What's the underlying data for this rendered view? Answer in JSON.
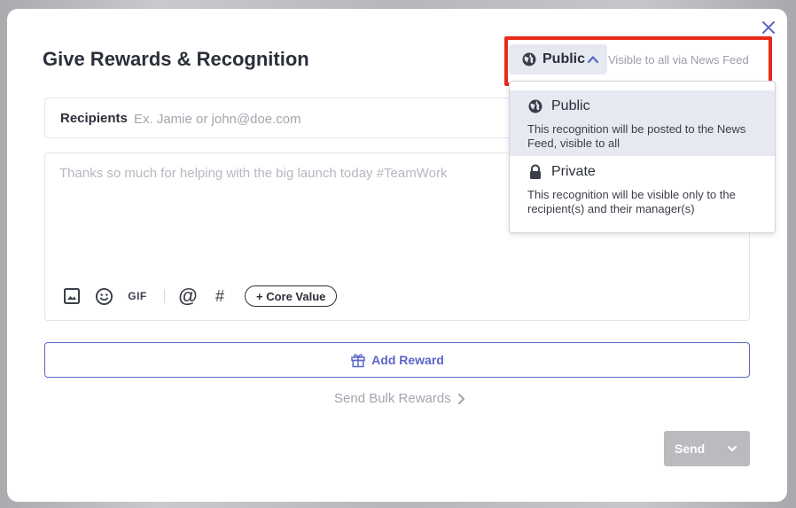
{
  "modal": {
    "title": "Give Rewards & Recognition"
  },
  "visibility": {
    "selected_label": "Public",
    "hint": "Visible to all via News Feed",
    "options": [
      {
        "label": "Public",
        "description": "This recognition will be posted to the News Feed, visible to all",
        "icon": "globe-icon"
      },
      {
        "label": "Private",
        "description": "This recognition will be visible only to the recipient(s) and their manager(s)",
        "icon": "lock-icon"
      }
    ]
  },
  "recipients": {
    "label": "Recipients",
    "placeholder": "Ex. Jamie or john@doe.com",
    "value": ""
  },
  "message": {
    "placeholder": "Thanks so much for helping with the big launch today #TeamWork",
    "value": ""
  },
  "toolbar": {
    "gif_label": "GIF",
    "mention_label": "@",
    "hashtag_label": "#",
    "core_value_label": "+ Core Value"
  },
  "actions": {
    "add_reward_label": "Add Reward",
    "bulk_label": "Send Bulk Rewards",
    "send_label": "Send"
  },
  "colors": {
    "accent": "#5b66c8",
    "highlight": "#e8291a",
    "send_disabled": "#b9bbbf"
  }
}
